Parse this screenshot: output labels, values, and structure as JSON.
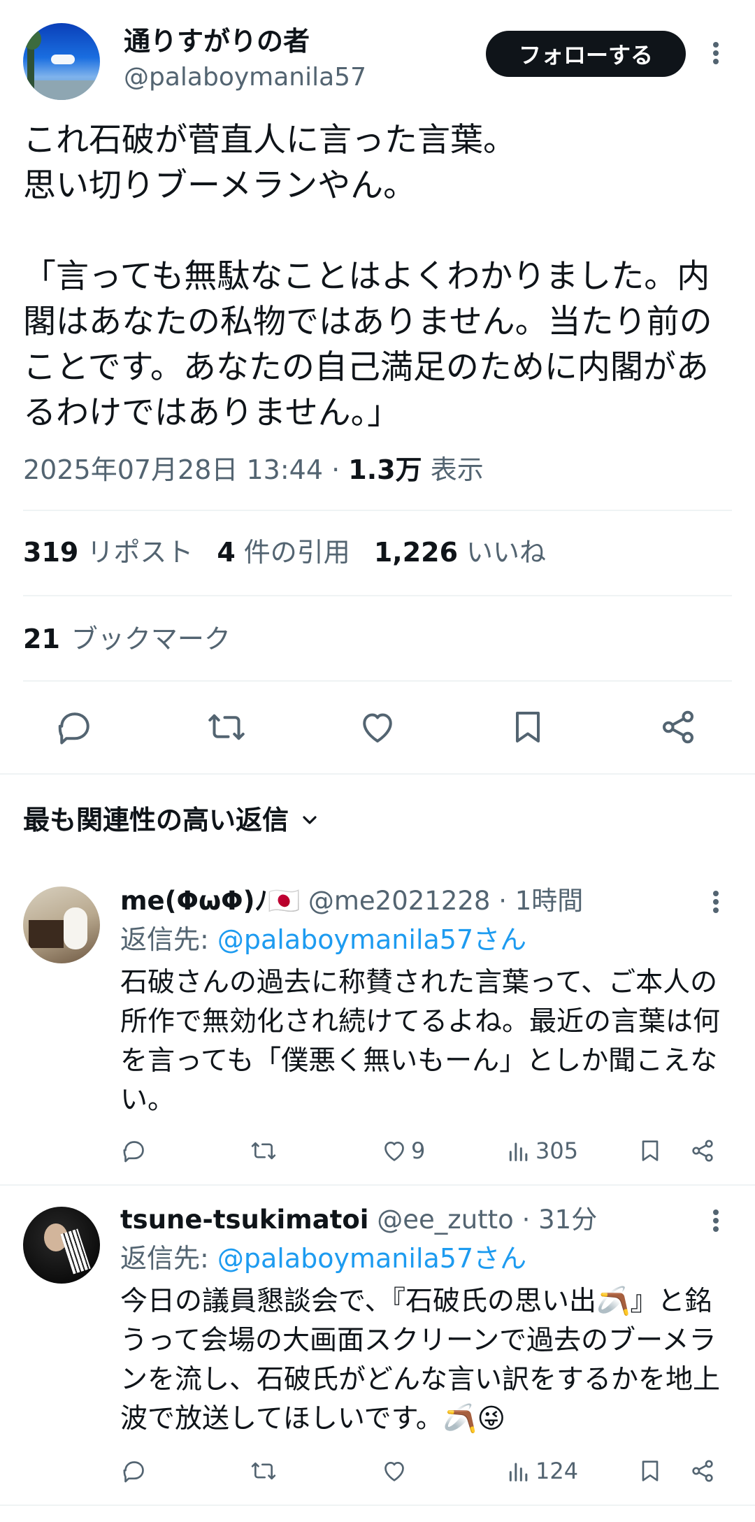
{
  "author": {
    "name": "通りすがりの者",
    "handle": "@palaboymanila57",
    "follow_label": "フォローする"
  },
  "tweet": {
    "text": "これ石破が菅直人に言った言葉。\n思い切りブーメランやん。\n\n「言っても無駄なことはよくわかりました。内閣はあなたの私物ではありません。当たり前のことです。あなたの自己満足のために内閣があるわけではありません。」",
    "timestamp": "2025年07月28日 13:44",
    "separator": " · ",
    "views": "1.3万",
    "views_label": "表示"
  },
  "stats": {
    "reposts": "319",
    "reposts_label": "リポスト",
    "quotes": "4",
    "quotes_label": "件の引用",
    "likes": "1,226",
    "likes_label": "いいね",
    "bookmarks": "21",
    "bookmarks_label": "ブックマーク"
  },
  "actions": {
    "icons": [
      "reply-icon",
      "repost-icon",
      "like-icon",
      "bookmark-icon",
      "share-icon"
    ]
  },
  "sort_label": "最も関連性の高い返信",
  "replies": [
    {
      "name": "me(ΦωΦ)ﾉ🇯🇵",
      "handle": "@me2021228",
      "time": "· 1時間",
      "reply_to_label": "返信先: ",
      "reply_to_handle": "@palaboymanila57さん",
      "text": "石破さんの過去に称賛された言葉って、ご本人の所作で無効化され続けてるよね。最近の言葉は何を言っても「僕悪く無いもーん」としか聞こえない。",
      "likes": "9",
      "views": "305"
    },
    {
      "name": "tsune-tsukimatoi",
      "handle": "@ee_zutto",
      "time": "· 31分",
      "reply_to_label": "返信先: ",
      "reply_to_handle": "@palaboymanila57さん",
      "text": "今日の議員懇談会で、『石破氏の思い出🪃』と銘うって会場の大画面スクリーンで過去のブーメランを流し、石破氏がどんな言い訳をするかを地上波で放送してほしいです。🪃😜",
      "likes": "",
      "views": "124"
    }
  ],
  "colors": {
    "text": "#0f1419",
    "muted": "#536471",
    "link": "#1d9bf0",
    "divider": "#eff3f4"
  }
}
